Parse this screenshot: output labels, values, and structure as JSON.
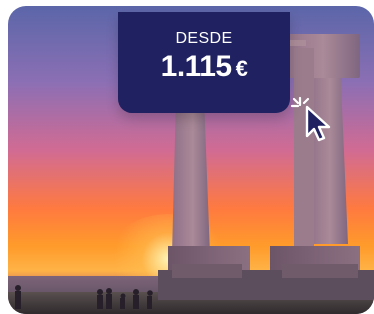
{
  "promo": {
    "prefix": "DESDE",
    "price": "1.115",
    "currency": "€"
  },
  "colors": {
    "banner": "#1f2161",
    "sky_top": "#5b66a9",
    "sky_mid": "#d16b93",
    "sunset": "#ff9b2b"
  },
  "icons": {
    "click": "cursor-click-icon"
  }
}
